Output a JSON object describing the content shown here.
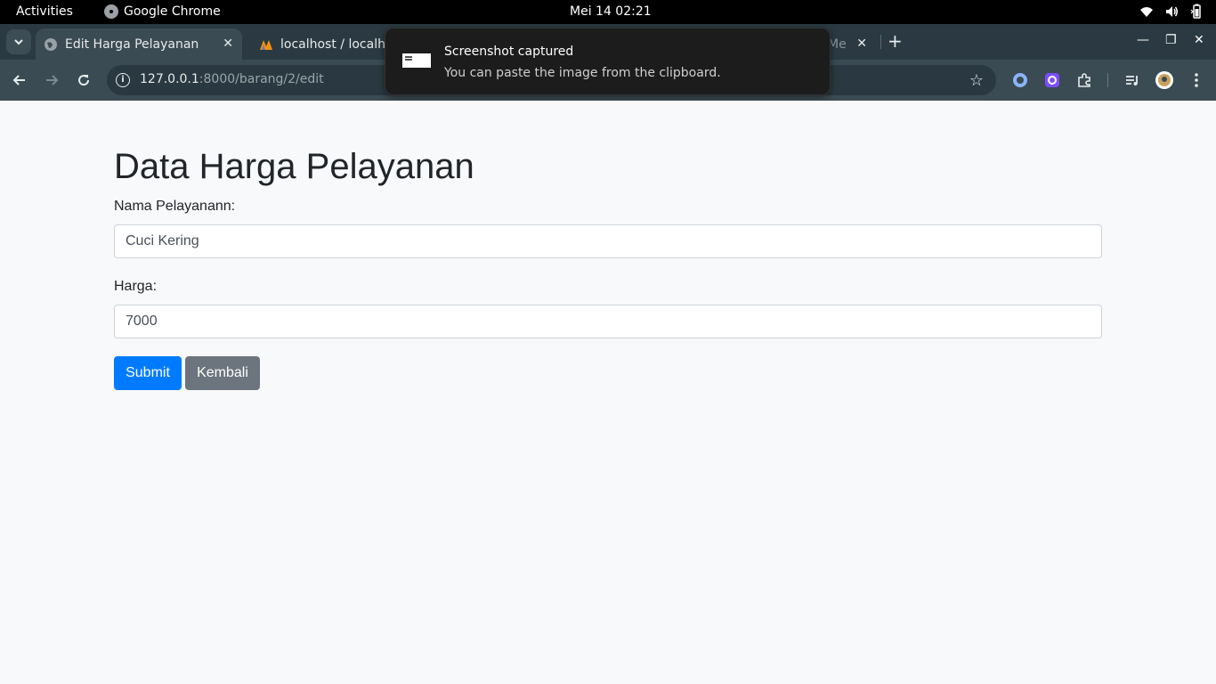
{
  "system_bar": {
    "activities": "Activities",
    "app_name": "Google Chrome",
    "clock": "Mei 14  02:21"
  },
  "browser": {
    "tabs": [
      {
        "title": "Edit Harga Pelayanan",
        "active": true
      },
      {
        "title": "localhost / localho",
        "active": false
      },
      {
        "title": "Me",
        "active": false
      }
    ],
    "url_host": "127.0.0.1",
    "url_path": ":8000/barang/2/edit"
  },
  "notification": {
    "title": "Screenshot captured",
    "body": "You can paste the image from the clipboard."
  },
  "form": {
    "heading": "Data Harga Pelayanan",
    "name_label": "Nama Pelayanann:",
    "name_value": "Cuci Kering",
    "price_label": "Harga:",
    "price_value": "7000",
    "submit_label": "Submit",
    "back_label": "Kembali"
  },
  "colors": {
    "primary": "#007bff",
    "secondary": "#6c757d",
    "page_bg": "#f8f9fa",
    "chrome_toolbar": "#3b4b53"
  }
}
